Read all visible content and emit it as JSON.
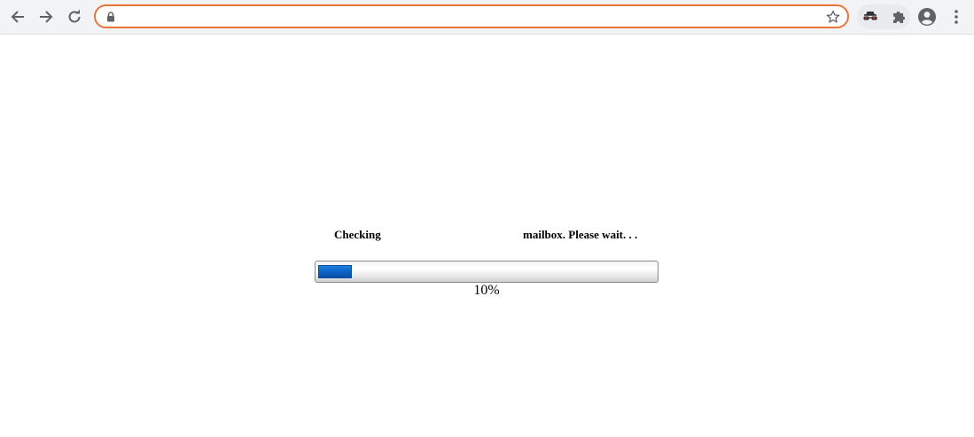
{
  "browser": {
    "address_bar": {
      "value": "",
      "placeholder": ""
    },
    "icons": {
      "back": "arrow-left-icon",
      "forward": "arrow-right-icon",
      "reload": "reload-icon",
      "lock": "lock-icon",
      "bookmark": "star-icon",
      "extension_1": "incognito-icon",
      "extensions": "puzzle-icon",
      "profile": "account-icon",
      "menu": "kebab-menu-icon"
    },
    "accent_color": "#e8743b"
  },
  "page": {
    "message_left": "Checking",
    "message_right": "mailbox. Please wait. . .",
    "progress": {
      "percent": 10,
      "label": "10%",
      "fill_color": "#0a63c7"
    }
  }
}
